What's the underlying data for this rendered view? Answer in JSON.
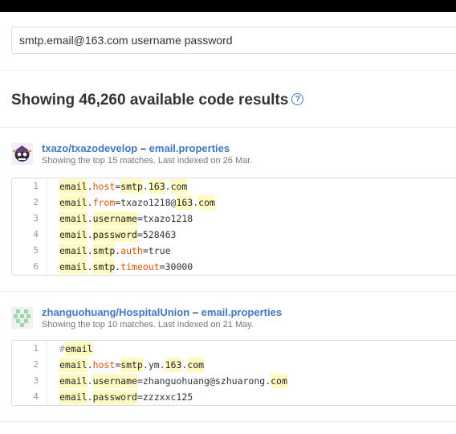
{
  "search": {
    "value": "smtp.email@163.com  username password"
  },
  "results_heading": "Showing 46,260 available code results",
  "help_icon": "?",
  "results": [
    {
      "repo": "txazo/txazodevelop",
      "dash": " – ",
      "file": "email.properties",
      "meta": "Showing the top 15 matches. Last indexed on 26 Mar.",
      "lines": [
        {
          "n": "1",
          "segments": [
            {
              "t": "email",
              "c": "hl"
            },
            {
              "t": ".",
              "c": ""
            },
            {
              "t": "host",
              "c": "key"
            },
            {
              "t": "=",
              "c": ""
            },
            {
              "t": "smtp",
              "c": "hl"
            },
            {
              "t": ".",
              "c": ""
            },
            {
              "t": "163",
              "c": "hl"
            },
            {
              "t": ".",
              "c": ""
            },
            {
              "t": "com",
              "c": "hl"
            }
          ]
        },
        {
          "n": "2",
          "segments": [
            {
              "t": "email",
              "c": "hl"
            },
            {
              "t": ".",
              "c": ""
            },
            {
              "t": "from",
              "c": "key"
            },
            {
              "t": "=txazo1218@",
              "c": ""
            },
            {
              "t": "163",
              "c": "hl"
            },
            {
              "t": ".",
              "c": ""
            },
            {
              "t": "com",
              "c": "hl"
            }
          ]
        },
        {
          "n": "3",
          "segments": [
            {
              "t": "email",
              "c": "hl"
            },
            {
              "t": ".",
              "c": ""
            },
            {
              "t": "username",
              "c": "hl"
            },
            {
              "t": "=txazo1218",
              "c": ""
            }
          ]
        },
        {
          "n": "4",
          "segments": [
            {
              "t": "email",
              "c": "hl"
            },
            {
              "t": ".",
              "c": ""
            },
            {
              "t": "password",
              "c": "hl"
            },
            {
              "t": "=528463",
              "c": ""
            }
          ]
        },
        {
          "n": "5",
          "segments": [
            {
              "t": "email",
              "c": "hl"
            },
            {
              "t": ".",
              "c": ""
            },
            {
              "t": "smtp",
              "c": "hl"
            },
            {
              "t": ".",
              "c": ""
            },
            {
              "t": "auth",
              "c": "key"
            },
            {
              "t": "=true",
              "c": ""
            }
          ]
        },
        {
          "n": "6",
          "segments": [
            {
              "t": "email",
              "c": "hl"
            },
            {
              "t": ".",
              "c": ""
            },
            {
              "t": "smtp",
              "c": "hl"
            },
            {
              "t": ".",
              "c": ""
            },
            {
              "t": "timeout",
              "c": "key"
            },
            {
              "t": "=30000",
              "c": ""
            }
          ]
        }
      ]
    },
    {
      "repo": "zhanguohuang/HospitalUnion",
      "dash": " – ",
      "file": "email.properties",
      "meta": "Showing the top 10 matches. Last indexed on 21 May.",
      "lines": [
        {
          "n": "1",
          "segments": [
            {
              "t": "#",
              "c": "hash"
            },
            {
              "t": "email",
              "c": "hl"
            }
          ]
        },
        {
          "n": "2",
          "segments": [
            {
              "t": "email",
              "c": "hl"
            },
            {
              "t": ".",
              "c": ""
            },
            {
              "t": "host",
              "c": "key"
            },
            {
              "t": "=",
              "c": ""
            },
            {
              "t": "smtp",
              "c": "hl"
            },
            {
              "t": ".ym.",
              "c": ""
            },
            {
              "t": "163",
              "c": "hl"
            },
            {
              "t": ".",
              "c": ""
            },
            {
              "t": "com",
              "c": "hl"
            }
          ]
        },
        {
          "n": "3",
          "segments": [
            {
              "t": "email",
              "c": "hl"
            },
            {
              "t": ".",
              "c": ""
            },
            {
              "t": "username",
              "c": "hl"
            },
            {
              "t": "=zhanguohuang@szhuarong.",
              "c": ""
            },
            {
              "t": "com",
              "c": "hl"
            }
          ]
        },
        {
          "n": "4",
          "segments": [
            {
              "t": "email",
              "c": "hl"
            },
            {
              "t": ".",
              "c": ""
            },
            {
              "t": "password",
              "c": "hl"
            },
            {
              "t": "=zzzxxc125",
              "c": ""
            }
          ]
        }
      ]
    }
  ],
  "colors": {
    "link": "#4078c0",
    "highlight": "#fffbc0",
    "key": "#df5000"
  }
}
